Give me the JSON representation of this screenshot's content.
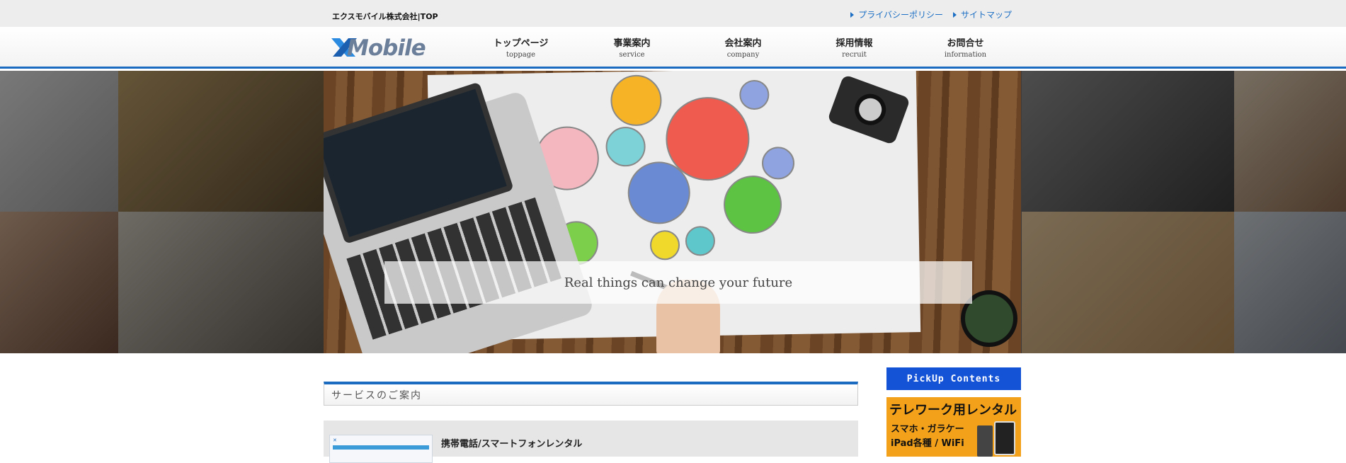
{
  "topbar": {
    "site_title": "エクスモバイル株式会社|TOP",
    "links": [
      {
        "label": "プライバシーポリシー"
      },
      {
        "label": "サイトマップ"
      }
    ]
  },
  "header": {
    "logo_text": "Mobile",
    "nav": [
      {
        "jp": "トップページ",
        "en": "toppage"
      },
      {
        "jp": "事業案内",
        "en": "service"
      },
      {
        "jp": "会社案内",
        "en": "company"
      },
      {
        "jp": "採用情報",
        "en": "recruit"
      },
      {
        "jp": "お問合せ",
        "en": "information"
      }
    ]
  },
  "hero": {
    "tagline": "Real things can change your future"
  },
  "content": {
    "section_title": "サービスのご案内",
    "service_title": "携帯電話/スマートフォンレンタル"
  },
  "sidebar": {
    "pickup_label": "PickUp Contents",
    "banner": {
      "line1": "テレワーク用レンタル",
      "line2": "スマホ・ガラケー",
      "line3": "iPad各種 / WiFi"
    }
  },
  "colors": {
    "accent_blue": "#1b6bc0",
    "pickup_blue": "#1553d6",
    "banner_orange": "#f3a11a"
  }
}
